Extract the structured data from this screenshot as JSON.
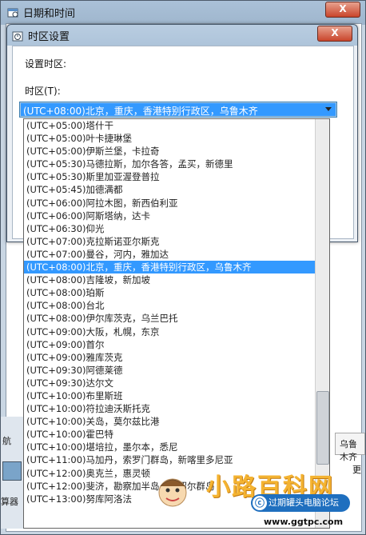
{
  "outer_window": {
    "title": "日期和时间",
    "close_label": "X",
    "right_fragment": "乌鲁木齐",
    "left_fragments": [
      "航",
      "算器"
    ],
    "right_edge_fragment": "更"
  },
  "dialog": {
    "title": "时区设置",
    "close_label": "X",
    "set_timezone_label": "设置时区:",
    "timezone_label": "时区(T):",
    "selected_value": "(UTC+08:00)北京，重庆，香港特别行政区，乌鲁木齐"
  },
  "timezone_list": [
    "(UTC+05:00)塔什干",
    "(UTC+05:00)叶卡捷琳堡",
    "(UTC+05:00)伊斯兰堡，卡拉奇",
    "(UTC+05:30)马德拉斯，加尔各答，孟买，新德里",
    "(UTC+05:30)斯里加亚渥登普拉",
    "(UTC+05:45)加德满都",
    "(UTC+06:00)阿拉木图，新西伯利亚",
    "(UTC+06:00)阿斯塔纳，达卡",
    "(UTC+06:30)仰光",
    "(UTC+07:00)克拉斯诺亚尔斯克",
    "(UTC+07:00)曼谷，河内，雅加达",
    "(UTC+08:00)北京，重庆，香港特别行政区，乌鲁木齐",
    "(UTC+08:00)吉隆坡，新加坡",
    "(UTC+08:00)珀斯",
    "(UTC+08:00)台北",
    "(UTC+08:00)伊尔库茨克，乌兰巴托",
    "(UTC+09:00)大阪，札幌，东京",
    "(UTC+09:00)首尔",
    "(UTC+09:00)雅库茨克",
    "(UTC+09:30)阿德莱德",
    "(UTC+09:30)达尔文",
    "(UTC+10:00)布里斯班",
    "(UTC+10:00)符拉迪沃斯托克",
    "(UTC+10:00)关岛，莫尔兹比港",
    "(UTC+10:00)霍巴特",
    "(UTC+10:00)堪培拉，墨尔本，悉尼",
    "(UTC+11:00)马加丹，索罗门群岛，新喀里多尼亚",
    "(UTC+12:00)奥克兰，惠灵顿",
    "(UTC+12:00)斐济，勘察加半岛，马绍尔群岛",
    "(UTC+13:00)努库阿洛法"
  ],
  "selected_index": 11,
  "watermark": {
    "brand": "小路百科网",
    "badge": "过期罐头电脑论坛",
    "url": "www.ggtpc.com"
  },
  "colors": {
    "selection": "#3399ff",
    "close_button": "#c9452b",
    "title_bar": "#aec4da"
  }
}
